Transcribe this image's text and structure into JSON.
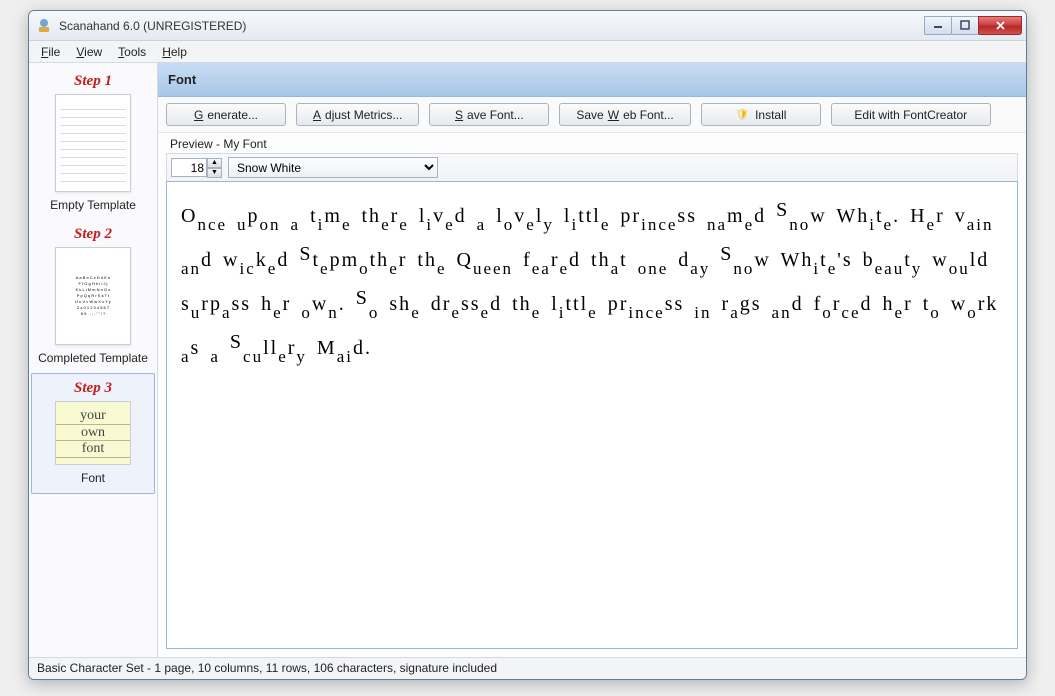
{
  "window": {
    "title": "Scanahand 6.0 (UNREGISTERED)"
  },
  "menu": {
    "file": "File",
    "view": "View",
    "tools": "Tools",
    "help": "Help"
  },
  "sidebar": {
    "step1": {
      "title": "Step 1",
      "label": "Empty Template"
    },
    "step2": {
      "title": "Step 2",
      "label": "Completed Template"
    },
    "step3": {
      "title": "Step 3",
      "label": "Font",
      "thumb_lines": [
        "your",
        "own",
        "font"
      ]
    }
  },
  "section": {
    "title": "Font"
  },
  "toolbar": {
    "generate": "Generate...",
    "adjust": "Adjust Metrics...",
    "save_font": "Save Font...",
    "save_web": "Save Web Font...",
    "install": "Install",
    "edit_fc": "Edit with FontCreator"
  },
  "preview": {
    "label": "Preview - My Font",
    "size": "18",
    "sample_name": "Snow White",
    "text": "Once upon a time there lived a lovely little princess named Snow White. Her vain and wicked Stepmother the Queen feared that one day Snow White's beauty would surpass her own. So she dressed the little princess in rags and forced her to work as a Scullery Maid."
  },
  "status": {
    "text": "Basic Character Set - 1 page, 10 columns, 11 rows, 106 characters, signature included"
  }
}
